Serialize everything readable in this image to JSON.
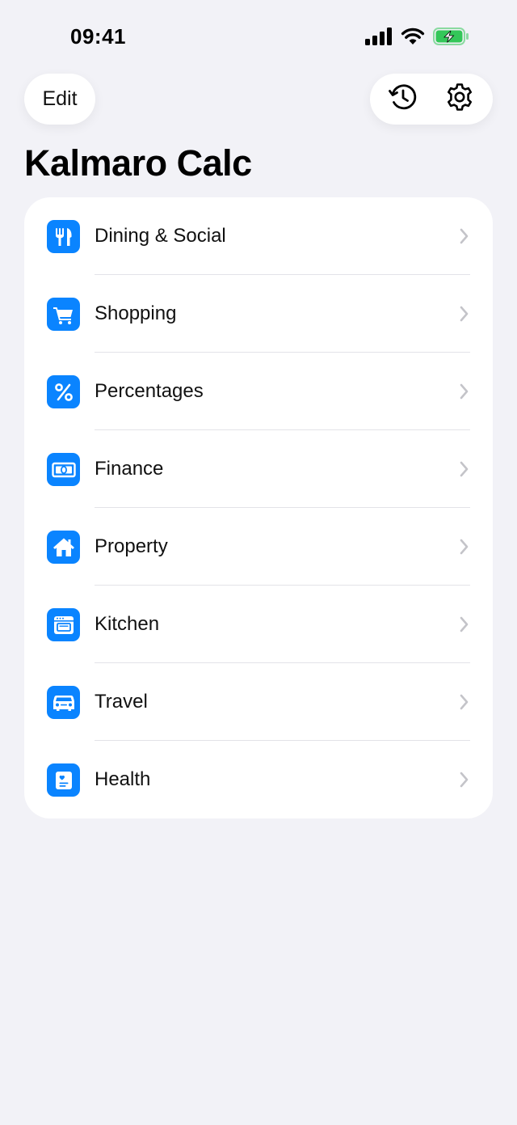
{
  "status_bar": {
    "time": "09:41",
    "signal_icon": "cellular-signal-icon",
    "wifi_icon": "wifi-icon",
    "battery_icon": "battery-charging-icon",
    "battery_color": "#34c759"
  },
  "header": {
    "edit_label": "Edit",
    "history_icon": "history-icon",
    "settings_icon": "gear-icon",
    "title": "Kalmaro Calc"
  },
  "accent_color": "#0a84ff",
  "categories": [
    {
      "label": "Dining & Social",
      "icon": "fork-knife-icon"
    },
    {
      "label": "Shopping",
      "icon": "cart-icon"
    },
    {
      "label": "Percentages",
      "icon": "percent-icon"
    },
    {
      "label": "Finance",
      "icon": "banknote-icon"
    },
    {
      "label": "Property",
      "icon": "house-icon"
    },
    {
      "label": "Kitchen",
      "icon": "oven-icon"
    },
    {
      "label": "Travel",
      "icon": "car-icon"
    },
    {
      "label": "Health",
      "icon": "health-card-icon"
    }
  ]
}
